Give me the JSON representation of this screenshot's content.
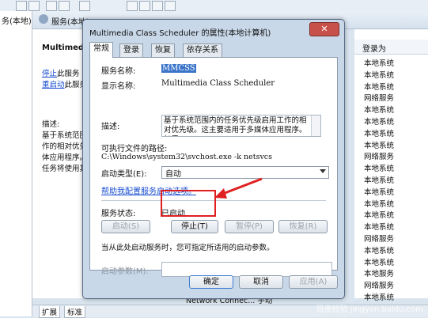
{
  "left_pane_label": "务(本地)",
  "services_header": "服务(本地)",
  "description_pane": {
    "service_name": "Multimedia",
    "stop_link": "停止",
    "stop_suffix": "此服务",
    "restart_link": "重启动",
    "restart_suffix": "此服务",
    "desc_label": "描述:",
    "desc_lines": [
      "基于系统范围",
      "作的相对优先",
      "体应用程序。",
      "任务将使用其"
    ]
  },
  "list": {
    "header": "登录为",
    "rows": [
      "本地系统",
      "本地系统",
      "本地系统",
      "网络服务",
      "本地系统",
      "本地系统",
      "本地系统",
      "本地系统",
      "网络服务",
      "本地系统",
      "本地系统",
      "本地系统",
      "本地系统",
      "本地系统",
      "本地系统",
      "网络服务",
      "本地系统",
      "本地系统",
      "本地服务",
      "网络服务",
      "本地系统"
    ]
  },
  "bottom": {
    "tab_expand": "扩展",
    "tab_standard": "标准",
    "status_row": "Network Connec...  手动"
  },
  "dialog": {
    "title": "Multimedia Class Scheduler 的属性(本地计算机)",
    "close": "✕",
    "tabs": [
      "常规",
      "登录",
      "恢复",
      "依存关系"
    ],
    "service_name_label": "服务名称:",
    "service_name_value": "MMCSS",
    "display_name_label": "显示名称:",
    "display_name_value": "Multimedia Class Scheduler",
    "description_label": "描述:",
    "description_value": "基于系统范围内的任务优先级启用工作的相对优先级。这主要适用于多媒体应用程序。如果",
    "exe_path_label": "可执行文件的路径:",
    "exe_path_value": "C:\\Windows\\system32\\svchost.exe -k netsvcs",
    "startup_type_label": "启动类型(E):",
    "startup_type_value": "自动",
    "help_link": "帮助我配置服务启动选项。",
    "status_label": "服务状态:",
    "status_value": "已启动",
    "start_button": "启动(S)",
    "stop_button": "停止(T)",
    "pause_button": "暂停(P)",
    "resume_button": "恢复(R)",
    "note": "当从此处启动服务时，您可指定所适用的启动参数。",
    "param_label": "启动参数(M):",
    "param_value": "",
    "ok_button": "确定",
    "cancel_button": "取消",
    "apply_button": "应用(A)"
  },
  "watermark": "百度经验 jingyan.baidu.com",
  "colors": {
    "highlight": "#e02020",
    "link": "#1a4fd0"
  }
}
